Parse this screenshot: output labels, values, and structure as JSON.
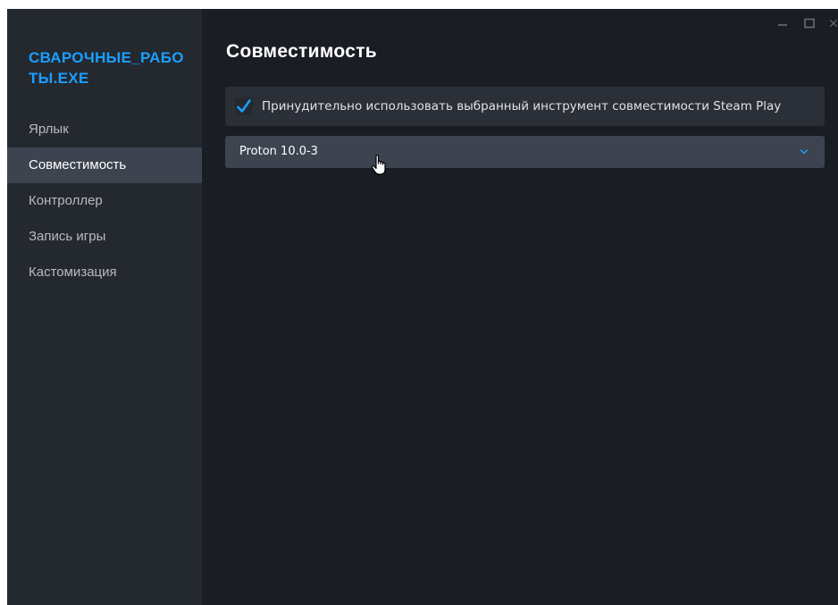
{
  "sidebar": {
    "game_title": "СВАРОЧНЫЕ_РАБОТЫ.EXE",
    "items": [
      {
        "label": "Ярлык",
        "active": false
      },
      {
        "label": "Совместимость",
        "active": true
      },
      {
        "label": "Контроллер",
        "active": false
      },
      {
        "label": "Запись игры",
        "active": false
      },
      {
        "label": "Кастомизация",
        "active": false
      }
    ]
  },
  "main": {
    "title": "Совместимость",
    "force_compat": {
      "label": "Принудительно использовать выбранный инструмент совместимости Steam Play",
      "checked": true
    },
    "compat_tool": {
      "selected": "Proton 10.0-3"
    }
  },
  "colors": {
    "accent": "#1a9fff",
    "sidebar_bg": "#24282f",
    "main_bg": "#1a1d24",
    "active_item_bg": "#3d4450",
    "panel_bg": "#2b2f38"
  },
  "icons": {
    "minimize": "minimize-icon",
    "maximize": "maximize-icon",
    "close": "close-icon",
    "checkmark": "checkmark-icon",
    "chevron": "chevron-down-icon",
    "cursor": "hand-pointer-cursor-icon"
  }
}
